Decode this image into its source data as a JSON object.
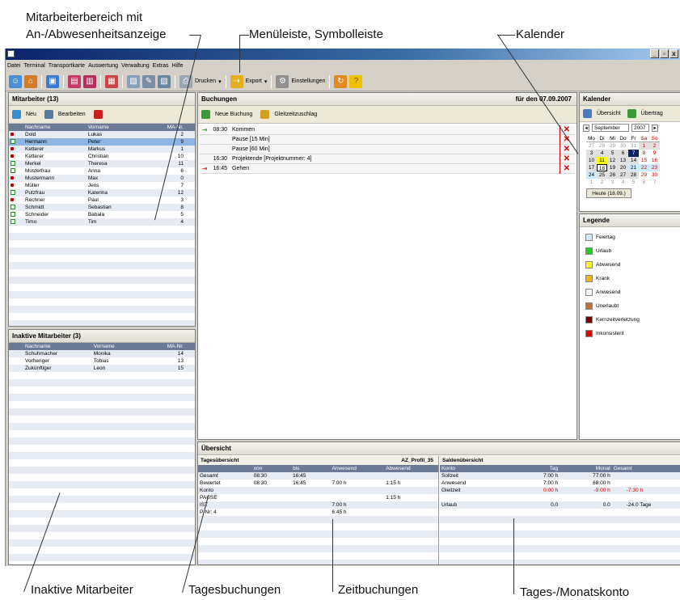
{
  "annotations": {
    "employee_area": [
      "Mitarbeiterbereich mit",
      "An-/Abwesenheitsanzeige"
    ],
    "menubar": "Menüleiste, Symbolleiste",
    "calendar": "Kalender",
    "inactive": "Inaktive Mitarbeiter",
    "day_bookings": "Tagesbuchungen",
    "time_bookings": "Zeitbuchungen",
    "account": "Tages-/Monatskonto"
  },
  "menu": [
    "Datei",
    "Terminal",
    "Transportkarte",
    "Auswertung",
    "Verwaltung",
    "Extras",
    "Hilfe"
  ],
  "window_buttons": [
    "_",
    "▫",
    "x"
  ],
  "toolbar": {
    "print": "Drucken",
    "export": "Export",
    "settings": "Einstellungen"
  },
  "employees": {
    "title": "Mitarbeiter (13)",
    "new": "Neu",
    "edit": "Bearbeiten",
    "columns": [
      "Nachname",
      "Vorname",
      "MA-Nr."
    ],
    "rows": [
      {
        "status": "dot",
        "last": "Dold",
        "first": "Lukas",
        "nr": "2"
      },
      {
        "status": "box",
        "last": "Hermann",
        "first": "Peter",
        "nr": "9",
        "selected": true
      },
      {
        "status": "dot",
        "last": "Ketterer",
        "first": "Markus",
        "nr": "1"
      },
      {
        "status": "dot",
        "last": "Ketterer",
        "first": "Christian",
        "nr": "10"
      },
      {
        "status": "box",
        "last": "Merkel",
        "first": "Theresa",
        "nr": "11"
      },
      {
        "status": "box",
        "last": "Musterfrau",
        "first": "Anna",
        "nr": "6"
      },
      {
        "status": "dot",
        "last": "Mustermann",
        "first": "Max",
        "nr": "0"
      },
      {
        "status": "dot",
        "last": "Müller",
        "first": "Jens",
        "nr": "7"
      },
      {
        "status": "box",
        "last": "Putzfrau",
        "first": "Katerina",
        "nr": "12"
      },
      {
        "status": "dot",
        "last": "Rechner",
        "first": "Paul",
        "nr": "3"
      },
      {
        "status": "box",
        "last": "Schmidt",
        "first": "Sebastian",
        "nr": "8"
      },
      {
        "status": "box",
        "last": "Schneider",
        "first": "Babala",
        "nr": "5"
      },
      {
        "status": "box",
        "last": "Timo",
        "first": "Tim",
        "nr": "4"
      }
    ]
  },
  "inactive": {
    "title": "Inaktive Mitarbeiter (3)",
    "columns": [
      "Nachname",
      "Vorname",
      "MA-Nr."
    ],
    "rows": [
      {
        "last": "Schuhmacher",
        "first": "Monika",
        "nr": "14"
      },
      {
        "last": "Vorheriger",
        "first": "Tobias",
        "nr": "13"
      },
      {
        "last": "Zukünftiger",
        "first": "Leon",
        "nr": "15"
      }
    ]
  },
  "bookings": {
    "title": "Buchungen",
    "date": "für den 07.09.2007",
    "new": "Neue Buchung",
    "flex": "Gleitzeitzuschlag",
    "rows": [
      {
        "icon": "in",
        "time": "08:30",
        "text": "Kommen"
      },
      {
        "icon": "",
        "time": "",
        "text": "Pause [15 Min]"
      },
      {
        "icon": "",
        "time": "",
        "text": "Pause [60 Min]"
      },
      {
        "icon": "",
        "time": "16:30",
        "text": "Projektende [Projektnummer: 4]"
      },
      {
        "icon": "out",
        "time": "16:45",
        "text": "Gehen"
      }
    ]
  },
  "calendar": {
    "title": "Kalender",
    "overview": "Übersicht",
    "transfer": "Übertrag",
    "month": "September",
    "year": "2007",
    "weekdays": [
      "Mo",
      "Di",
      "Mi",
      "Do",
      "Fr",
      "Sa",
      "So"
    ],
    "days": [
      [
        "27",
        "28",
        "29",
        "30",
        "31",
        "1",
        "2"
      ],
      [
        "3",
        "4",
        "5",
        "6",
        "7",
        "8",
        "9"
      ],
      [
        "10",
        "11",
        "12",
        "13",
        "14",
        "15",
        "16"
      ],
      [
        "17",
        "18",
        "19",
        "20",
        "21",
        "22",
        "23"
      ],
      [
        "24",
        "25",
        "26",
        "27",
        "28",
        "29",
        "30"
      ],
      [
        "1",
        "2",
        "3",
        "4",
        "5",
        "6",
        "7"
      ]
    ],
    "today": "Heute (18.09.)"
  },
  "legend": {
    "title": "Legende",
    "items": [
      {
        "label": "Feiertag",
        "color": "#cdeaff"
      },
      {
        "label": "Urlaub",
        "color": "#19d219"
      },
      {
        "label": "Abwesend",
        "color": "#ffff00"
      },
      {
        "label": "Krank",
        "color": "#f5b400"
      },
      {
        "label": "Anwesend",
        "color": "#f4f4f4"
      },
      {
        "label": "Unerlaubt",
        "color": "#c07030"
      },
      {
        "label": "Kernzeitverletzung",
        "color": "#7a0000"
      },
      {
        "label": "Inkonsistent",
        "color": "#e00000"
      }
    ]
  },
  "overview": {
    "title": "Übersicht",
    "day_title": "Tagesübersicht",
    "profile": "AZ_Profil_35",
    "day_columns": [
      "",
      "von",
      "bis",
      "Anwesend",
      "Abwesend"
    ],
    "day_rows": [
      [
        "Gesamt",
        "08:30",
        "16:45",
        "",
        ""
      ],
      [
        "Bewertet",
        "08:30",
        "16:45",
        "7:00 h",
        "1:15 h"
      ],
      [
        "Konto",
        "",
        "",
        "",
        ""
      ],
      [
        "PAUSE",
        "",
        "",
        "",
        "1:15 h"
      ],
      [
        "IST",
        "",
        "",
        "7:00 h",
        ""
      ],
      [
        "P-Nr: 4",
        "",
        "",
        "6:45 h",
        ""
      ]
    ],
    "saldo_title": "Saldenübersicht",
    "saldo_columns": [
      "Konto",
      "Tag",
      "Monat",
      "Gesamt"
    ],
    "saldo_rows": [
      {
        "cells": [
          "Sollzeit",
          "7:00 h",
          "77:00 h",
          ""
        ],
        "red": false
      },
      {
        "cells": [
          "Anwesend",
          "7:00 h",
          "68:00 h",
          ""
        ],
        "red": false
      },
      {
        "cells": [
          "Gleitzeit",
          "0:00 h",
          "-9:00 h",
          "-7:30 h"
        ],
        "red": true
      },
      {
        "cells": [
          "",
          "",
          "",
          ""
        ],
        "red": false
      },
      {
        "cells": [
          "Urlaub",
          "0.0",
          "0.0",
          "-24.0 Tage"
        ],
        "red": false
      }
    ]
  }
}
